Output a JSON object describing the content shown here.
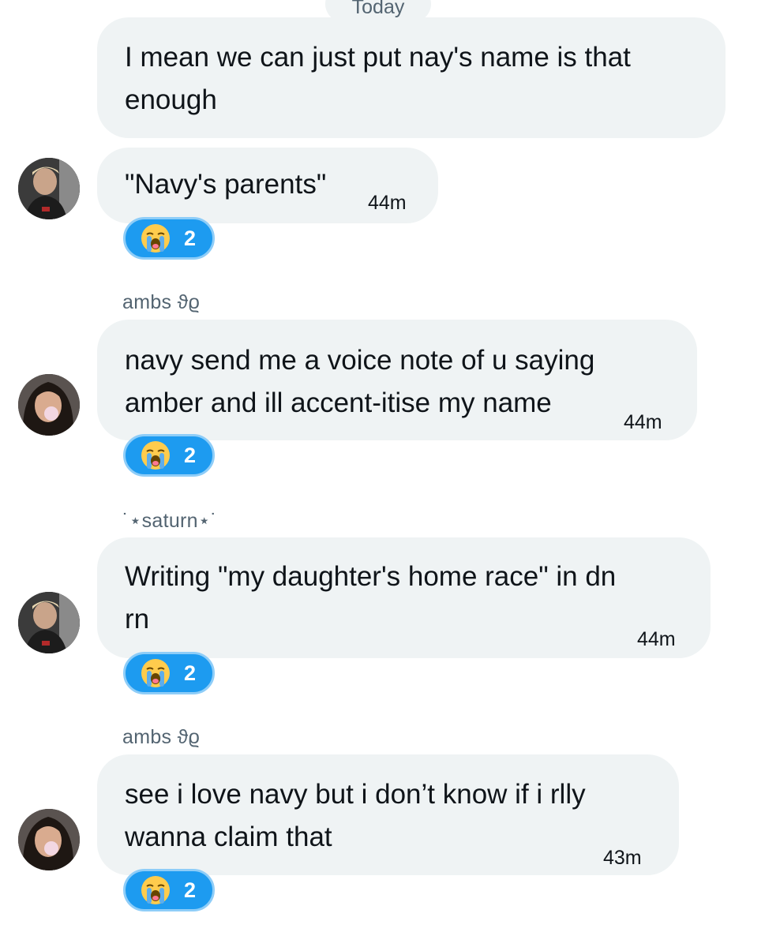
{
  "date_divider": "Today",
  "messages": [
    {
      "sender": "",
      "text_lines": [
        "I mean we can just put nay's name is that",
        "enough"
      ],
      "time": "",
      "reaction": null
    },
    {
      "sender": "",
      "text_lines": [
        "\"Navy's parents\""
      ],
      "time": "44m",
      "reaction": {
        "emoji": "loudly-crying-face",
        "count": "2"
      }
    },
    {
      "sender": "ambs ϑϱ",
      "text_lines": [
        "navy send me a voice note of u saying",
        "amber and ill accent-itise my name"
      ],
      "time": "44m",
      "reaction": {
        "emoji": "loudly-crying-face",
        "count": "2"
      }
    },
    {
      "sender": "˙⋆saturn⋆˙",
      "text_lines": [
        "Writing \"my daughter's home race\" in dn",
        "rn"
      ],
      "time": "44m",
      "reaction": {
        "emoji": "loudly-crying-face",
        "count": "2"
      }
    },
    {
      "sender": "ambs ϑϱ",
      "text_lines": [
        "see i love navy but i don’t know if i rlly",
        "wanna claim that"
      ],
      "time": "43m",
      "reaction": {
        "emoji": "loudly-crying-face",
        "count": "2"
      }
    }
  ],
  "colors": {
    "bubble_bg": "#eff3f4",
    "reaction_bg": "#1d9bf0",
    "reaction_border": "#8ecdf8",
    "meta_text": "#536471"
  }
}
